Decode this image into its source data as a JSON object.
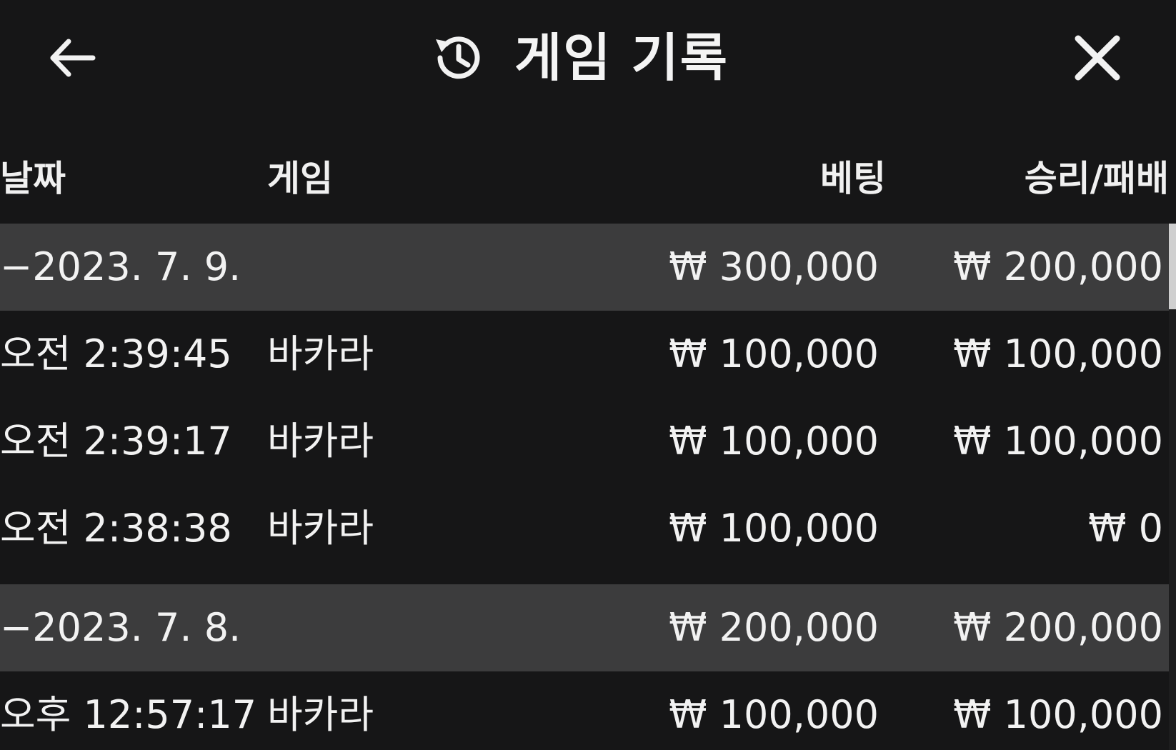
{
  "header": {
    "title": "게임 기록",
    "back_icon": "arrow-left-icon",
    "history_icon": "history-icon",
    "close_icon": "close-icon"
  },
  "columns": {
    "date": "날짜",
    "game": "게임",
    "bet": "베팅",
    "result": "승리/패배"
  },
  "rows": [
    {
      "type": "group",
      "date": "−2023. 7. 9.",
      "game": "",
      "bet": "₩ 300,000",
      "result": "₩ 200,000"
    },
    {
      "type": "entry",
      "date": "오전 2:39:45",
      "game": "바카라",
      "bet": "₩ 100,000",
      "result": "₩ 100,000"
    },
    {
      "type": "entry",
      "date": "오전 2:39:17",
      "game": "바카라",
      "bet": "₩ 100,000",
      "result": "₩ 100,000"
    },
    {
      "type": "entry",
      "date": "오전 2:38:38",
      "game": "바카라",
      "bet": "₩ 100,000",
      "result": "₩ 0"
    },
    {
      "type": "group",
      "date": "−2023. 7. 8.",
      "game": "",
      "bet": "₩ 200,000",
      "result": "₩ 200,000"
    },
    {
      "type": "entry",
      "date": "오후 12:57:17",
      "game": "바카라",
      "bet": "₩ 100,000",
      "result": "₩ 100,000"
    }
  ],
  "colors": {
    "background": "#161617",
    "group_row": "#3c3c3d",
    "text": "#f2f2f2"
  }
}
